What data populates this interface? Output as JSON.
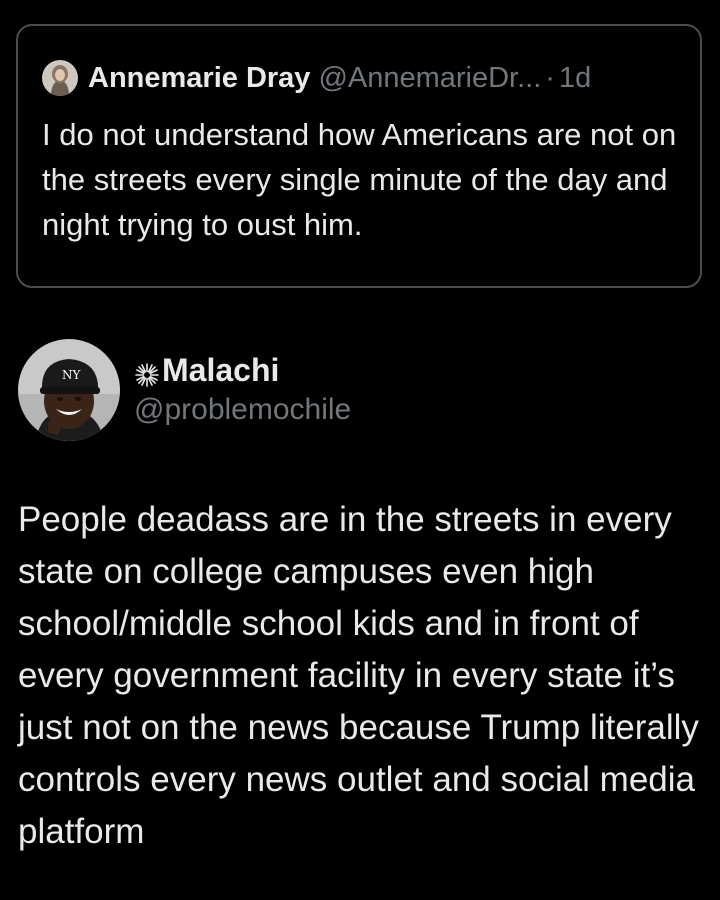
{
  "quoted_tweet": {
    "display_name": "Annemarie Dray",
    "handle": "@AnnemarieDr...",
    "separator": "·",
    "time": "1d",
    "text": "I do not understand how Americans are not on the streets every single minute of the day and night trying to oust him."
  },
  "post": {
    "display_name": "Malachi",
    "name_icon": "sparkle-icon",
    "handle": "@problemochile",
    "text": "People deadass are in the streets in every state on college campuses even high school/middle school kids and in front of every government facility in every state it’s just not on the news because Trump literally controls every news outlet and social media platform"
  },
  "colors": {
    "background": "#000000",
    "text_primary": "#e7e9ea",
    "text_secondary": "#71767b",
    "card_border": "#4a4d52"
  }
}
